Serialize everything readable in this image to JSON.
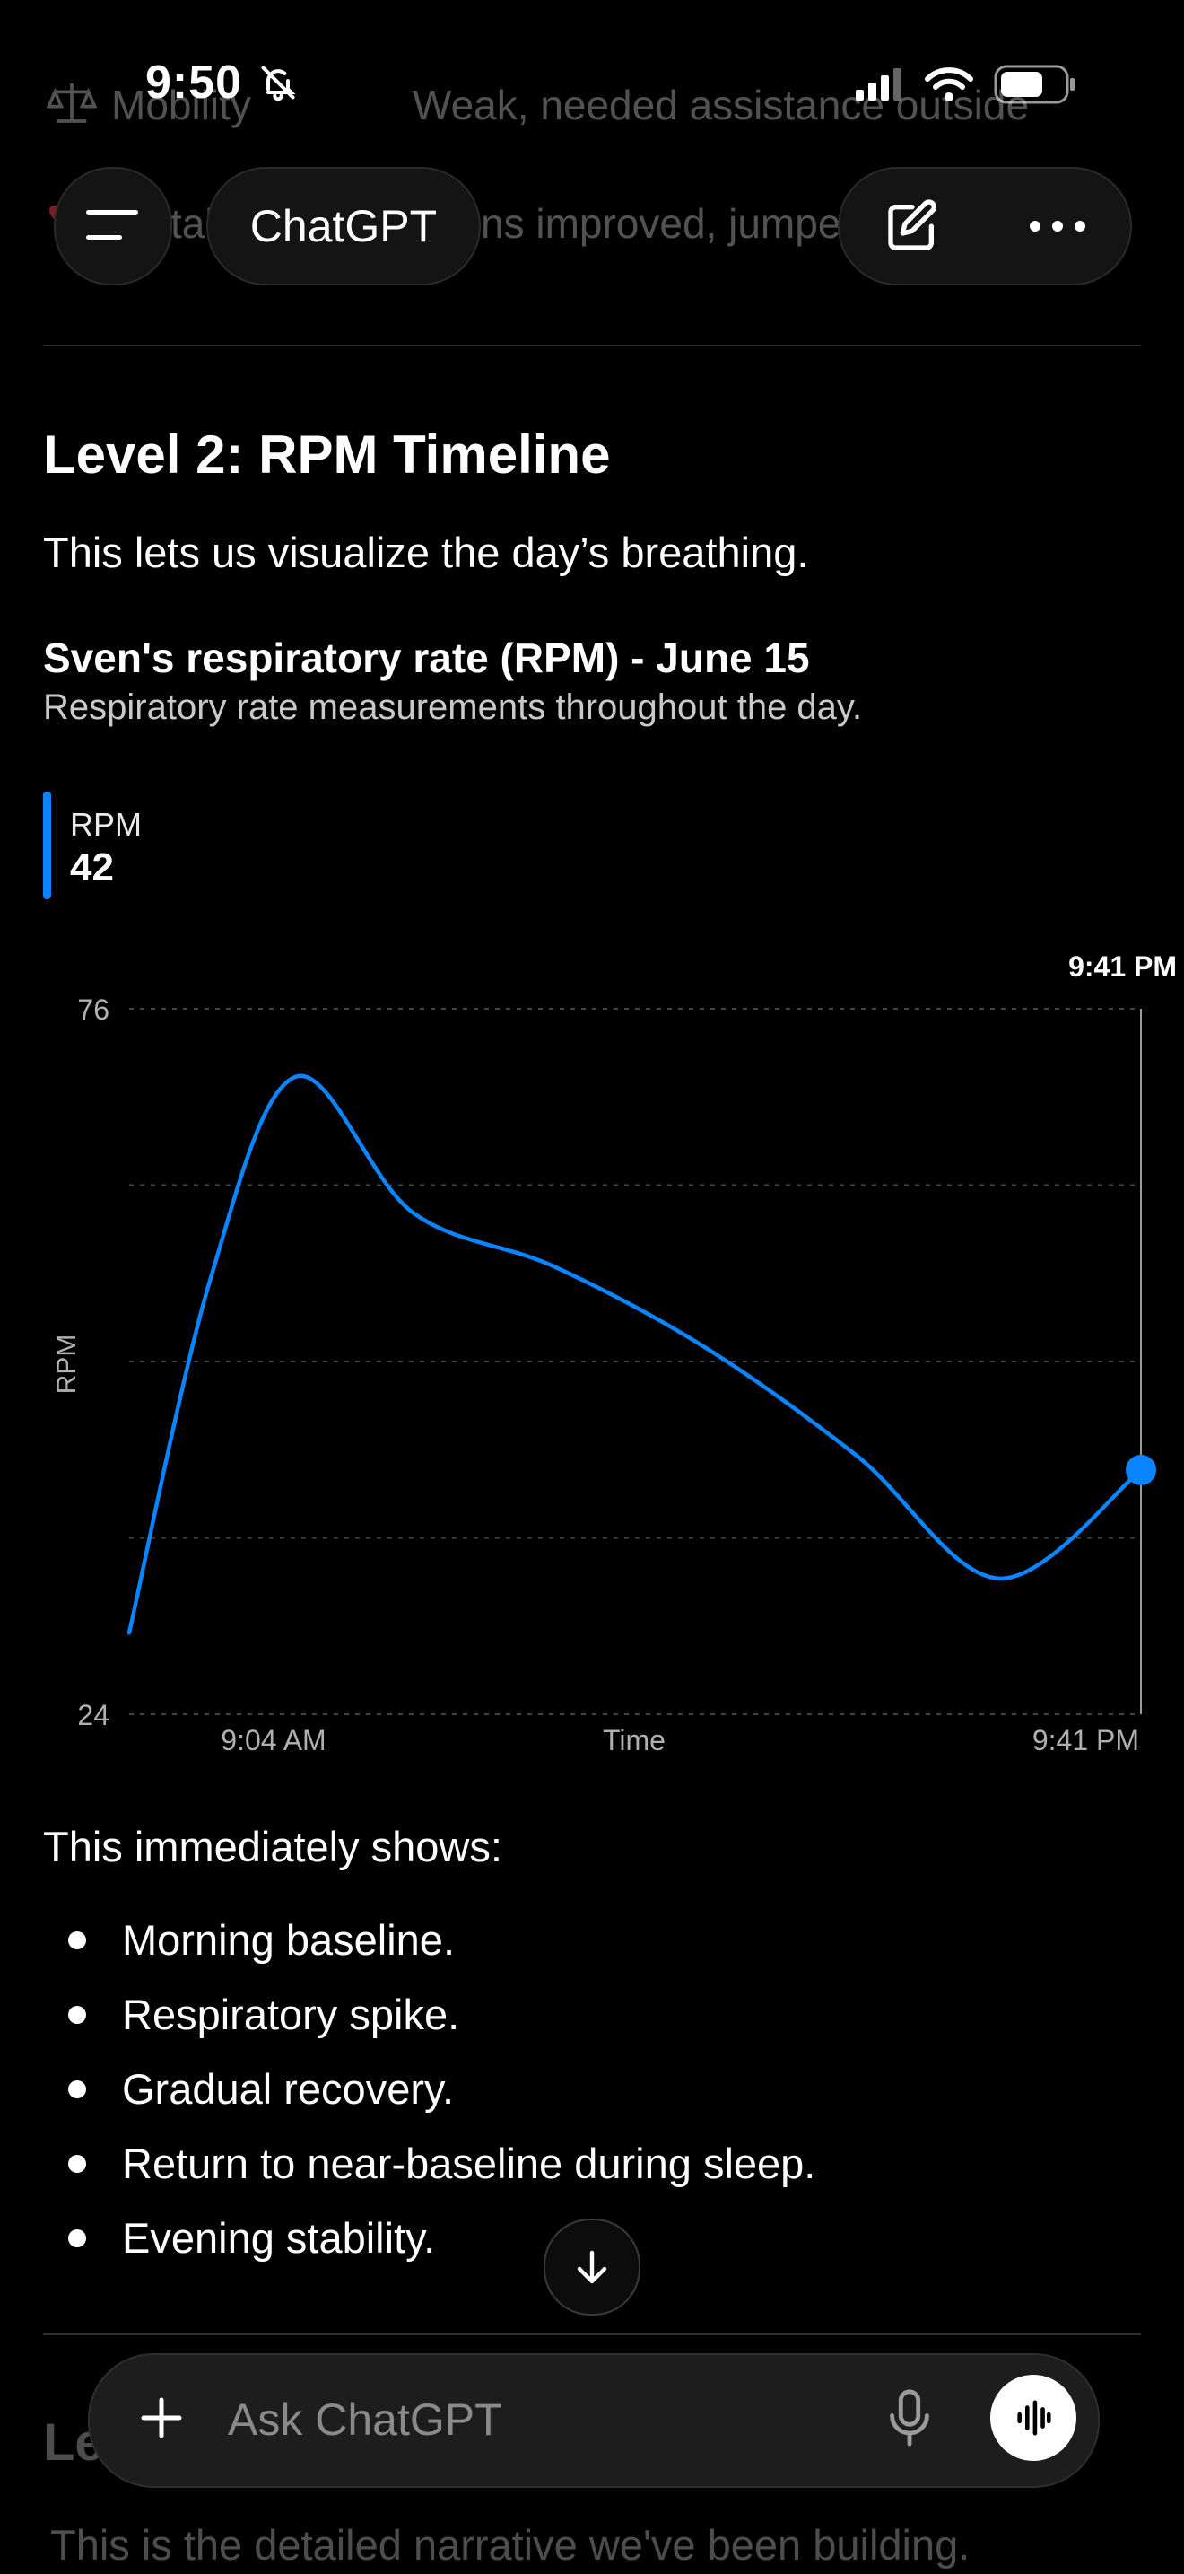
{
  "status_bar": {
    "time": "9:50"
  },
  "background_content": {
    "row1_label": "Mobility",
    "row1_value": "Weak, needed assistance outside",
    "row2_label": "tal",
    "row2_value": "ns improved, jumpe",
    "next_heading": "Le",
    "next_para": "This is the detailed narrative we've been building."
  },
  "header": {
    "title": "ChatGPT"
  },
  "section": {
    "heading": "Level 2: RPM Timeline",
    "intro": "This lets us visualize the day’s breathing."
  },
  "chart_data": {
    "type": "line",
    "title": "Sven's respiratory rate (RPM) - June 15",
    "subtitle": "Respiratory rate measurements throughout the day.",
    "legend": {
      "name": "RPM",
      "value": "42"
    },
    "ylabel": "RPM",
    "xlabel": "Time",
    "ylim": [
      24,
      76
    ],
    "y_ticks": [
      "76",
      "24"
    ],
    "x_ticks": [
      "9:04 AM",
      "9:41 PM"
    ],
    "cursor_label": "9:41 PM",
    "series": [
      {
        "name": "RPM",
        "x": [
          0.0,
          0.08,
          0.165,
          0.28,
          0.42,
          0.57,
          0.72,
          0.86,
          1.0
        ],
        "values": [
          30,
          56,
          71,
          61,
          57,
          51,
          43,
          34,
          42
        ]
      }
    ],
    "color": "#0a84ff"
  },
  "summary": {
    "lead": "This immediately shows:",
    "bullets": [
      "Morning baseline.",
      "Respiratory spike.",
      "Gradual recovery.",
      "Return to near-baseline during sleep.",
      "Evening stability."
    ]
  },
  "composer": {
    "placeholder": "Ask ChatGPT"
  },
  "icons": [
    "bell-slash-icon",
    "signal-icon",
    "wifi-icon",
    "battery-icon",
    "menu-icon",
    "edit-icon",
    "more-icon",
    "scale-icon",
    "heart-icon",
    "arrow-down-icon",
    "plus-icon",
    "mic-icon",
    "voice-wave-icon"
  ]
}
